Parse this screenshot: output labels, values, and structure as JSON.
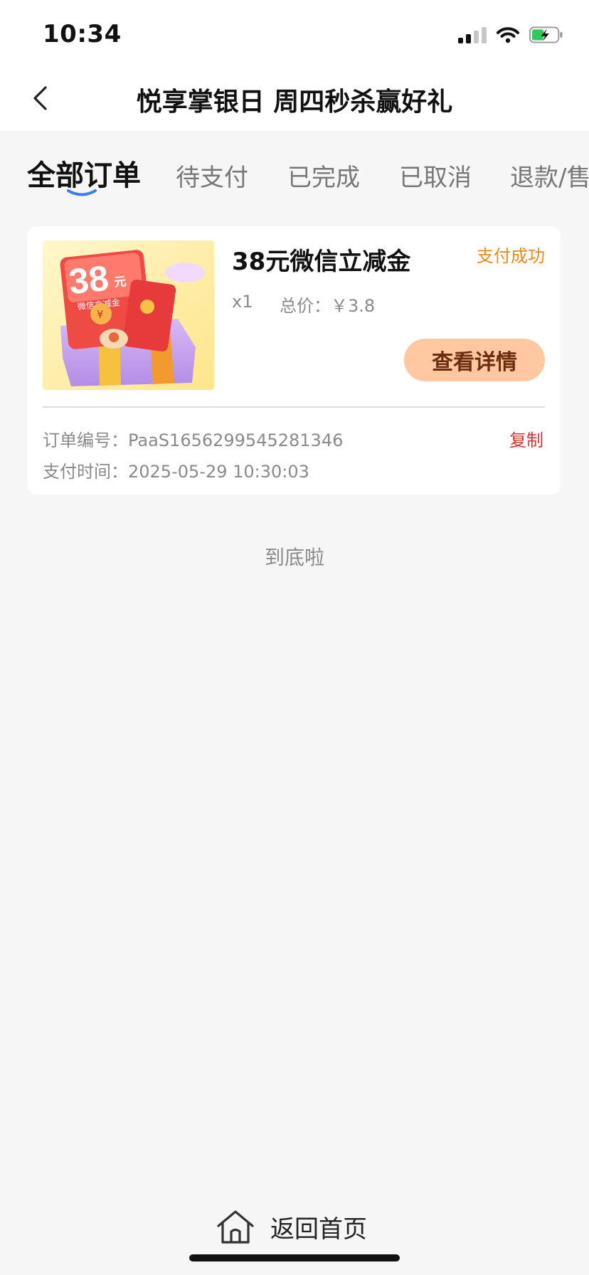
{
  "status_bar": {
    "time": "10:34"
  },
  "header": {
    "title": "悦享掌银日 周四秒杀赢好礼"
  },
  "tabs": [
    {
      "label": "全部订单",
      "active": true
    },
    {
      "label": "待支付"
    },
    {
      "label": "已完成"
    },
    {
      "label": "已取消"
    },
    {
      "label": "退款/售后"
    }
  ],
  "order": {
    "thumb": {
      "amount": "38",
      "unit": "元",
      "subtitle": "微信立减金",
      "currency": "¥"
    },
    "product_name": "38元微信立减金",
    "status": "支付成功",
    "quantity": "x1",
    "total_label": "总价：",
    "total_value": "￥3.8",
    "detail_button": "查看详情",
    "order_no_label": "订单编号：",
    "order_no": "PaaS1656299545281346",
    "copy_label": "复制",
    "pay_time_label": "支付时间：",
    "pay_time": "2025-05-29 10:30:03"
  },
  "list_end": "到底啦",
  "bottom": {
    "home_label": "返回首页"
  },
  "colors": {
    "accent_status": "#ea8a1c",
    "copy": "#d6332f",
    "detail_button_bg": "#ffc8a0",
    "tab_underline": "#3b7ef0"
  }
}
